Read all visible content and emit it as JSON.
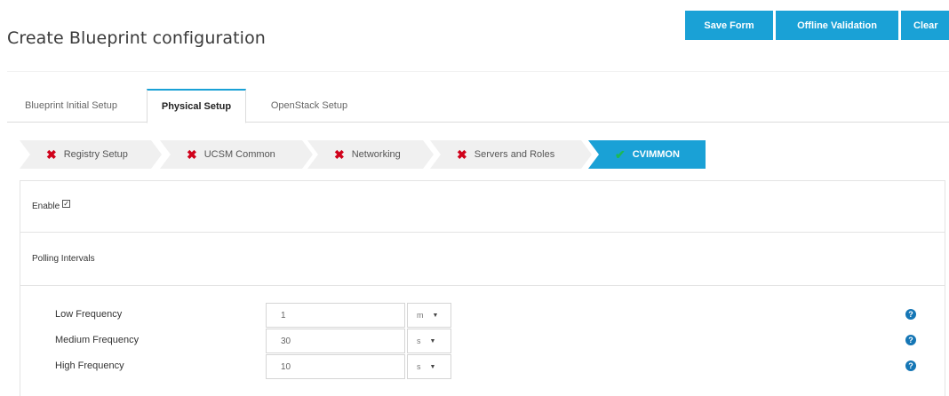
{
  "page": {
    "title": "Create Blueprint configuration"
  },
  "toolbar": {
    "save_label": "Save Form",
    "offline_label": "Offline Validation",
    "clear_label": "Clear"
  },
  "tabs": [
    {
      "label": "Blueprint Initial Setup",
      "active": false
    },
    {
      "label": "Physical Setup",
      "active": true
    },
    {
      "label": "OpenStack Setup",
      "active": false
    }
  ],
  "wizard": {
    "steps": [
      {
        "label": "Registry Setup",
        "status": "error",
        "icon": "x-icon"
      },
      {
        "label": "UCSM Common",
        "status": "error",
        "icon": "x-icon"
      },
      {
        "label": "Networking",
        "status": "error",
        "icon": "x-icon"
      },
      {
        "label": "Servers and Roles",
        "status": "error",
        "icon": "x-icon"
      },
      {
        "label": "CVIMMON",
        "status": "ok",
        "icon": "check-icon",
        "active": true
      }
    ]
  },
  "cvimmon": {
    "enable_label": "Enable",
    "enable_checked": true,
    "polling_label": "Polling Intervals",
    "frequencies": [
      {
        "label": "Low Frequency",
        "value": "1",
        "unit": "m"
      },
      {
        "label": "Medium Frequency",
        "value": "30",
        "unit": "s"
      },
      {
        "label": "High Frequency",
        "value": "10",
        "unit": "s"
      }
    ]
  },
  "colors": {
    "accent": "#1aa1d6",
    "error": "#d0021b",
    "ok": "#1db954",
    "step_bg": "#f0f0f0",
    "help": "#1576b5"
  }
}
